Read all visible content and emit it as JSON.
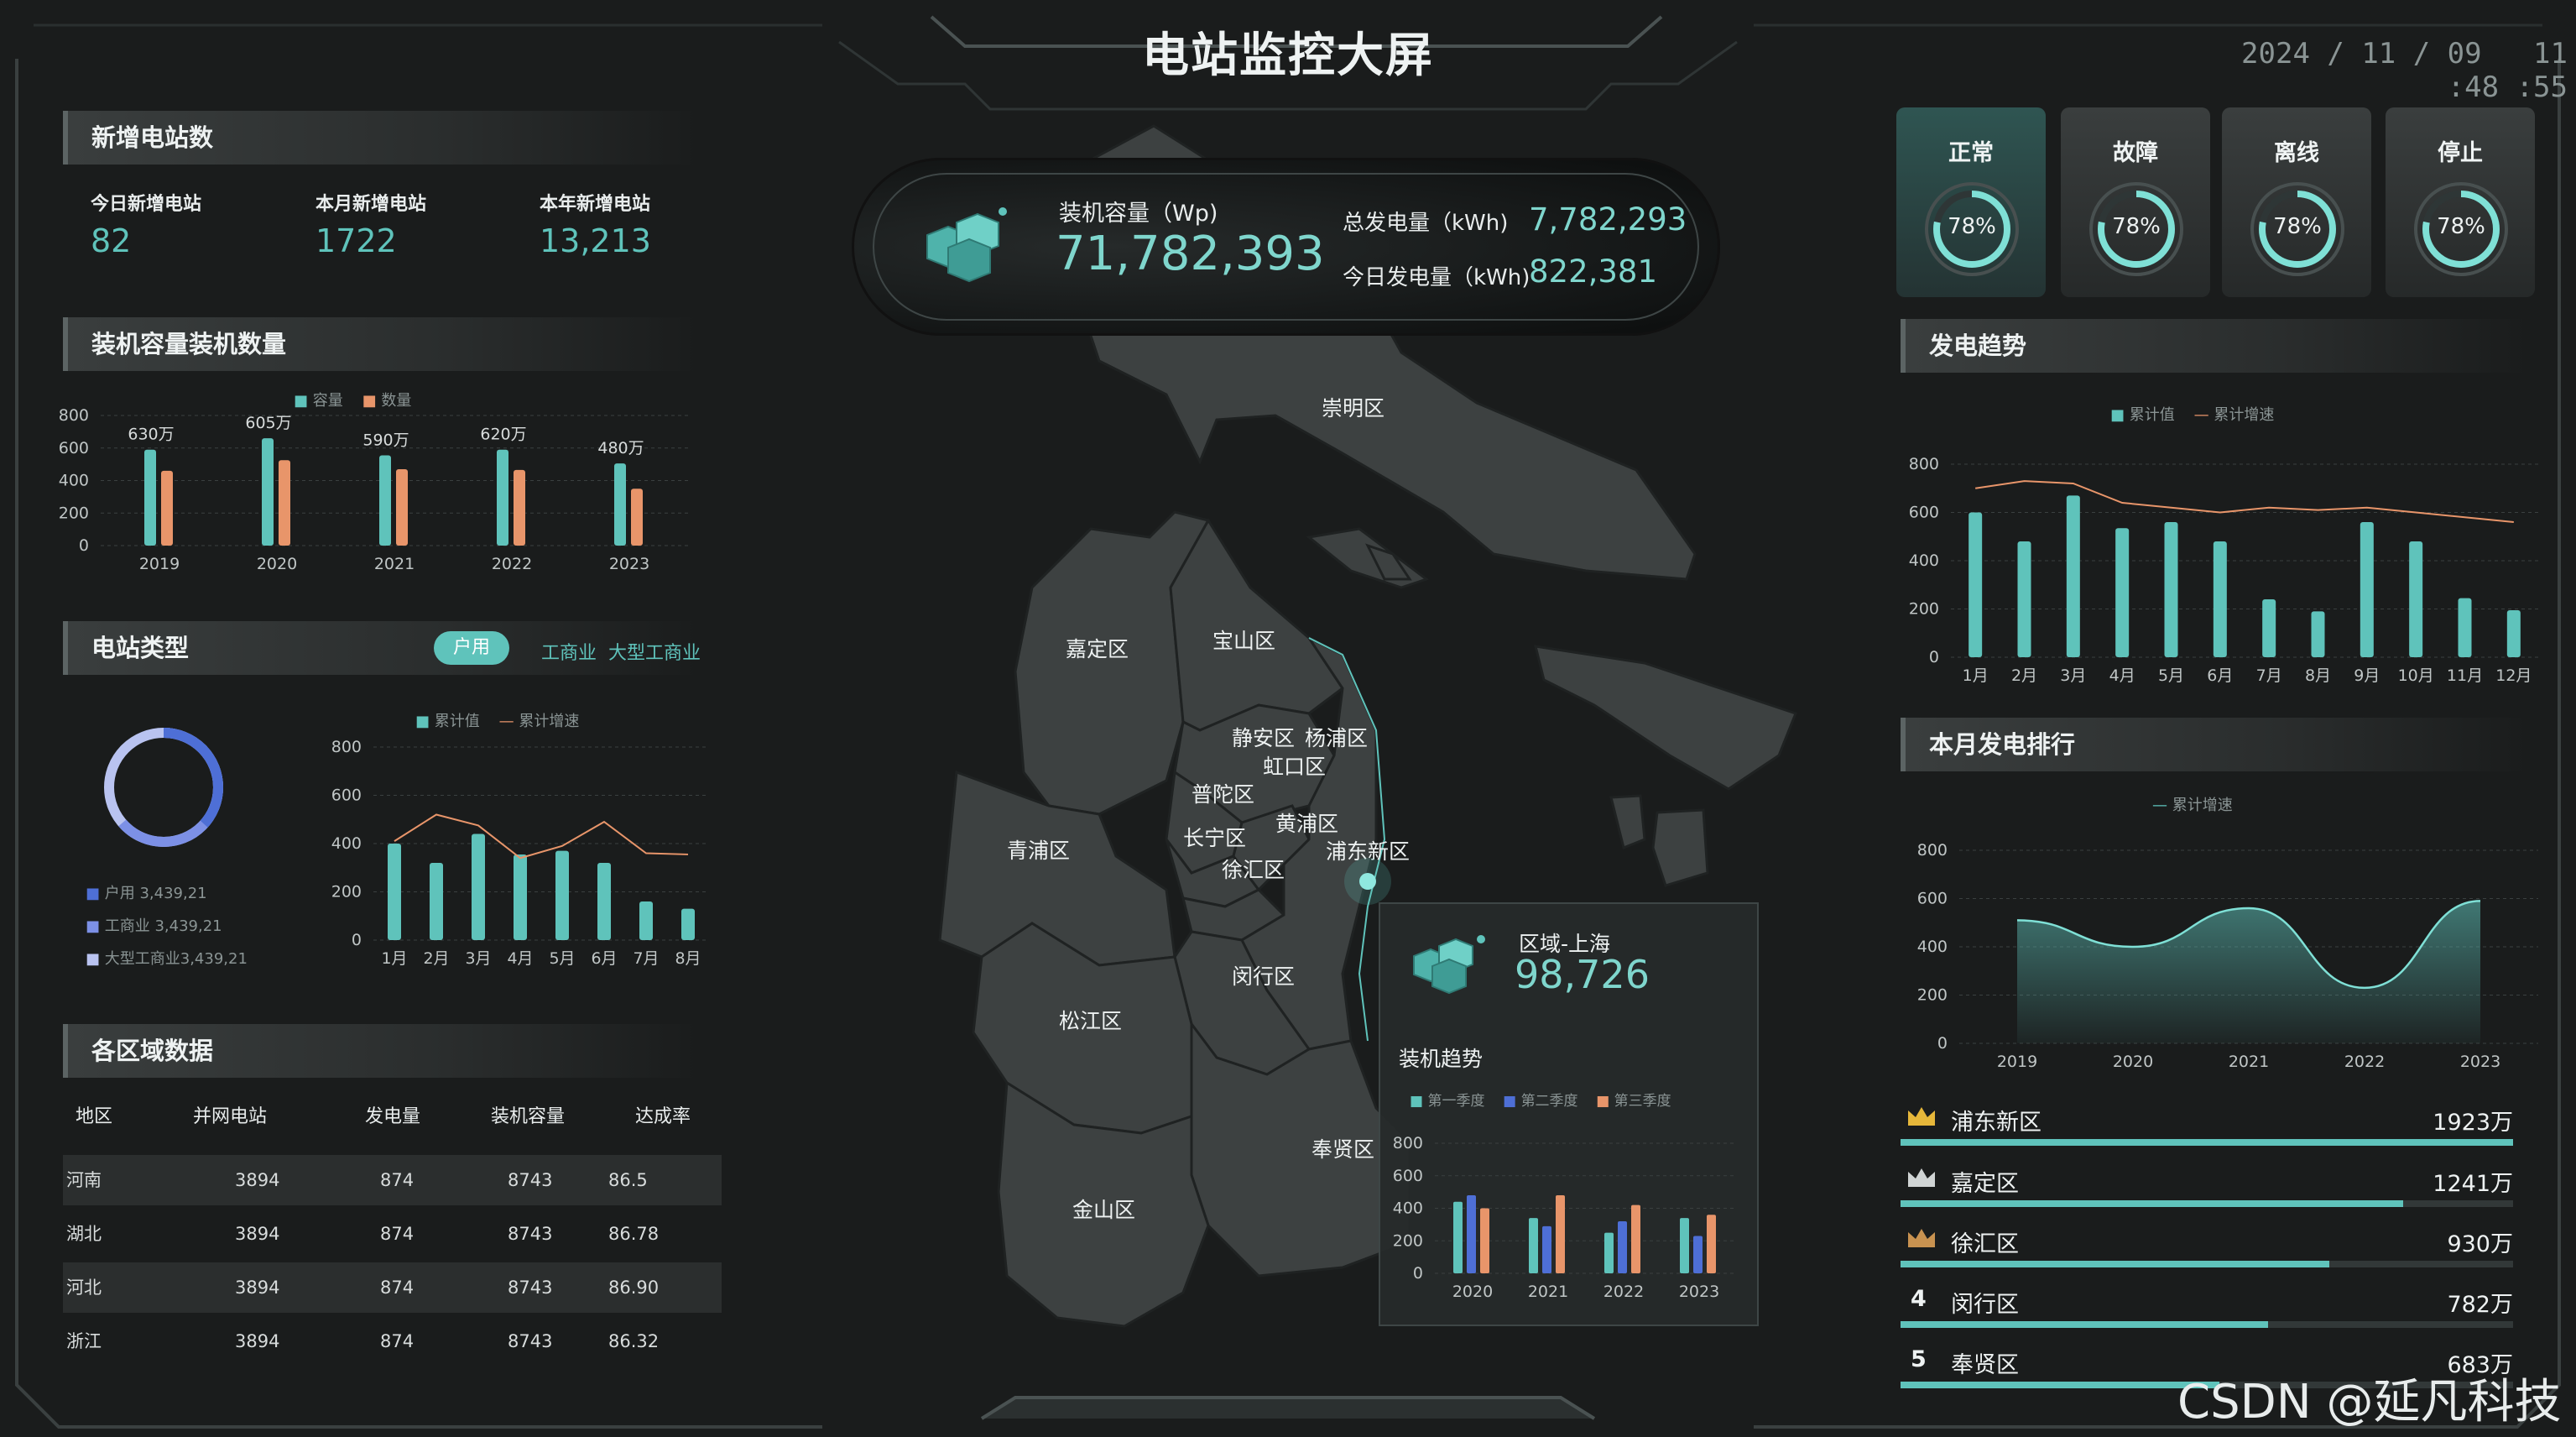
{
  "header": {
    "title": "电站监控大屏",
    "date": "2024 / 11 / 09",
    "time": "11 :48 :55"
  },
  "new_stations": {
    "title": "新增电站数",
    "items": [
      {
        "label": "今日新增电站",
        "value": "82"
      },
      {
        "label": "本月新增电站",
        "value": "1722"
      },
      {
        "label": "本年新增电站",
        "value": "13,213"
      }
    ]
  },
  "capacity_panel": {
    "title": "装机容量装机数量",
    "legend": [
      "容量",
      "数量"
    ],
    "chart_data": {
      "type": "bar",
      "categories": [
        "2019",
        "2020",
        "2021",
        "2022",
        "2023"
      ],
      "series": [
        {
          "name": "容量",
          "values": [
            590,
            660,
            555,
            590,
            505
          ]
        },
        {
          "name": "数量",
          "values": [
            460,
            525,
            470,
            465,
            350
          ]
        }
      ],
      "data_labels": [
        "630万",
        "605万",
        "590万",
        "620万",
        "480万"
      ],
      "yticks": [
        "800",
        "600",
        "400",
        "200",
        "0"
      ],
      "ylim": [
        0,
        800
      ]
    }
  },
  "station_type": {
    "title": "电站类型",
    "tabs": [
      "户用",
      "工商业",
      "大型工商业"
    ],
    "donut_legend": [
      {
        "label": "户用  3,439,21",
        "color": "#4e6fd6"
      },
      {
        "label": "工商业  3,439,21",
        "color": "#7c90e6"
      },
      {
        "label": "大型工商业3,439,21",
        "color": "#b9c3f0"
      }
    ],
    "chart_legend": [
      "累计值",
      "累计增速"
    ],
    "chart_data": {
      "type": "bar",
      "categories": [
        "1月",
        "2月",
        "3月",
        "4月",
        "5月",
        "6月",
        "7月",
        "8月"
      ],
      "series": [
        {
          "name": "累计值",
          "values": [
            400,
            320,
            440,
            355,
            370,
            320,
            160,
            130
          ]
        },
        {
          "name": "累计增速",
          "values": [
            410,
            520,
            475,
            340,
            390,
            490,
            360,
            355
          ]
        }
      ],
      "yticks": [
        "800",
        "600",
        "400",
        "200",
        "0"
      ],
      "ylim": [
        0,
        800
      ]
    }
  },
  "region_table": {
    "title": "各区域数据",
    "headers": [
      "地区",
      "并网电站",
      "发电量",
      "装机容量",
      "达成率"
    ],
    "rows": [
      [
        "河南",
        "3894",
        "874",
        "8743",
        "86.5"
      ],
      [
        "湖北",
        "3894",
        "874",
        "8743",
        "86.78"
      ],
      [
        "河北",
        "3894",
        "874",
        "8743",
        "86.90"
      ],
      [
        "浙江",
        "3894",
        "874",
        "8743",
        "86.32"
      ]
    ]
  },
  "kpi": {
    "capacity_label": "装机容量（Wp)",
    "capacity_value": "71,782,393",
    "total_gen_label": "总发电量（kWh)",
    "total_gen_value": "7,782,293",
    "today_gen_label": "今日发电量（kWh)",
    "today_gen_value": "822,381"
  },
  "map": {
    "districts": [
      "崇明区",
      "嘉定区",
      "宝山区",
      "静安区",
      "杨浦区",
      "虹口区",
      "普陀区",
      "黄浦区",
      "长宁区",
      "浦东新区",
      "徐汇区",
      "青浦区",
      "闵行区",
      "松江区",
      "奉贤区",
      "金山区"
    ],
    "popup": {
      "region": "区域-上海",
      "value": "98,726",
      "chart_title": "装机趋势",
      "legend": [
        "第一季度",
        "第二季度",
        "第三季度"
      ],
      "chart_data": {
        "type": "bar",
        "categories": [
          "2020",
          "2021",
          "2022",
          "2023"
        ],
        "series": [
          {
            "name": "第一季度",
            "values": [
              440,
              340,
              250,
              340
            ]
          },
          {
            "name": "第二季度",
            "values": [
              480,
              290,
              320,
              230
            ]
          },
          {
            "name": "第三季度",
            "values": [
              400,
              480,
              420,
              360
            ]
          }
        ],
        "yticks": [
          "800",
          "600",
          "400",
          "200",
          "0"
        ],
        "ylim": [
          0,
          800
        ]
      }
    }
  },
  "status": [
    {
      "label": "正常",
      "value": "78%",
      "active": true
    },
    {
      "label": "故障",
      "value": "78%"
    },
    {
      "label": "离线",
      "value": "78%"
    },
    {
      "label": "停止",
      "value": "78%"
    }
  ],
  "trend": {
    "title": "发电趋势",
    "legend": [
      "累计值",
      "累计增速"
    ],
    "chart_data": {
      "type": "bar",
      "categories": [
        "1月",
        "2月",
        "3月",
        "4月",
        "5月",
        "6月",
        "7月",
        "8月",
        "9月",
        "10月",
        "11月",
        "12月"
      ],
      "series": [
        {
          "name": "累计值",
          "values": [
            600,
            480,
            670,
            535,
            560,
            480,
            240,
            190,
            560,
            480,
            245,
            195
          ]
        },
        {
          "name": "累计增速",
          "values": [
            700,
            730,
            720,
            640,
            620,
            600,
            620,
            610,
            620,
            600,
            580,
            560
          ]
        }
      ],
      "yticks": [
        "800",
        "600",
        "400",
        "200",
        "0"
      ],
      "ylim": [
        0,
        800
      ]
    }
  },
  "monthly": {
    "title": "本月发电排行",
    "legend": [
      "累计增速"
    ],
    "chart_data": {
      "type": "area",
      "categories": [
        "2019",
        "2020",
        "2021",
        "2022",
        "2023"
      ],
      "values": [
        510,
        400,
        560,
        230,
        590
      ],
      "yticks": [
        "800",
        "600",
        "400",
        "200",
        "0"
      ],
      "ylim": [
        0,
        800
      ]
    },
    "ranking": [
      {
        "rank": "1",
        "name": "浦东新区",
        "value": "1923万",
        "fraction": 1.0,
        "medal": "#e6b73a"
      },
      {
        "rank": "2",
        "name": "嘉定区",
        "value": "1241万",
        "fraction": 0.82,
        "medal": "#d0d4d4"
      },
      {
        "rank": "3",
        "name": "徐汇区",
        "value": "930万",
        "fraction": 0.7,
        "medal": "#c89250"
      },
      {
        "rank": "4",
        "name": "闵行区",
        "value": "782万",
        "fraction": 0.6
      },
      {
        "rank": "5",
        "name": "奉贤区",
        "value": "683万",
        "fraction": 0.52
      }
    ]
  },
  "watermark": "CSDN @延凡科技"
}
